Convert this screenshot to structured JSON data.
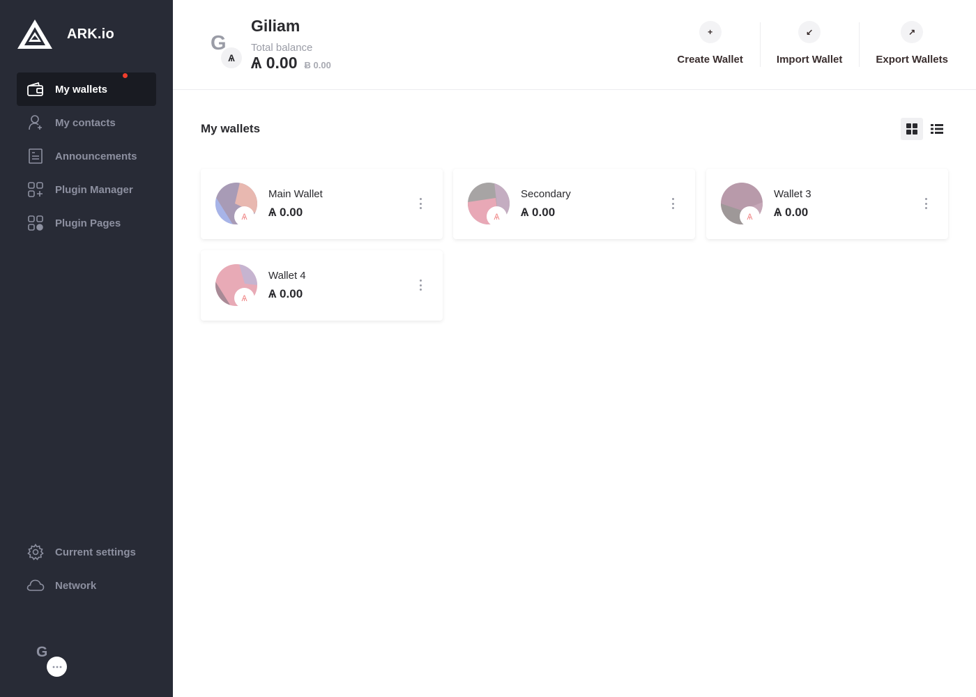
{
  "brand": {
    "name": "ARK.io"
  },
  "sidebar": {
    "items": [
      {
        "label": "My wallets",
        "icon": "wallet-icon",
        "active": true
      },
      {
        "label": "My contacts",
        "icon": "contacts-icon"
      },
      {
        "label": "Announcements",
        "icon": "announcements-icon",
        "notification": true
      },
      {
        "label": "Plugin Manager",
        "icon": "plugin-manager-icon"
      },
      {
        "label": "Plugin Pages",
        "icon": "plugin-pages-icon"
      }
    ],
    "bottom_items": [
      {
        "label": "Current settings",
        "icon": "gear-icon"
      },
      {
        "label": "Network",
        "icon": "cloud-icon"
      }
    ],
    "profile_initial": "G"
  },
  "header": {
    "avatar_initial": "G",
    "currency_symbol": "Ѧ",
    "profile_name": "Giliam",
    "balance_label": "Total balance",
    "balance": "Ѧ 0.00",
    "balance_alt": "Ƀ 0.00",
    "actions": [
      {
        "label": "Create Wallet",
        "icon": "plus-icon",
        "glyph": "+"
      },
      {
        "label": "Import Wallet",
        "icon": "import-icon",
        "glyph": "↙"
      },
      {
        "label": "Export Wallets",
        "icon": "export-icon",
        "glyph": "↗"
      }
    ]
  },
  "main": {
    "title": "My wallets",
    "view_mode": "grid",
    "wallets": [
      {
        "name": "Main Wallet",
        "balance": "Ѧ 0.00",
        "colors": [
          "#a89bb6",
          "#e8b8b0",
          "#a7b4e8"
        ]
      },
      {
        "name": "Secondary",
        "balance": "Ѧ 0.00",
        "colors": [
          "#a7a4a4",
          "#e8a8b6",
          "#c4adc1"
        ]
      },
      {
        "name": "Wallet 3",
        "balance": "Ѧ 0.00",
        "colors": [
          "#b89aaa",
          "#9e9898",
          "#c6a8b8"
        ]
      },
      {
        "name": "Wallet 4",
        "balance": "Ѧ 0.00",
        "colors": [
          "#e8aab6",
          "#a88a96",
          "#c6b4d0"
        ]
      }
    ]
  },
  "colors": {
    "sidebar_bg": "#282b36",
    "sidebar_active_bg": "#191b22",
    "notification": "#ef3e2d",
    "accent_text": "#3a2e2e"
  }
}
